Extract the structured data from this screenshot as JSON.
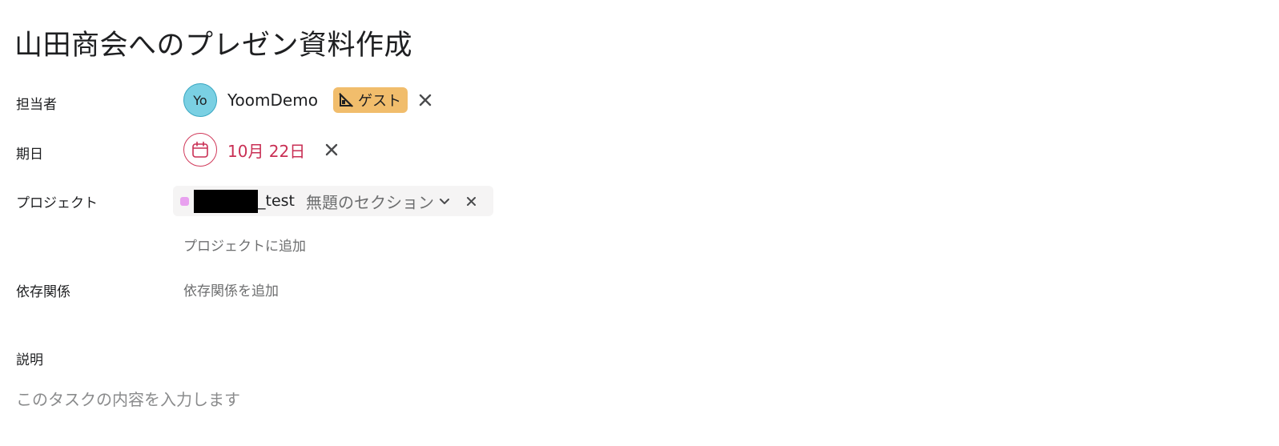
{
  "task": {
    "title": "山田商会へのプレゼン資料作成"
  },
  "fields": {
    "assignee": {
      "label": "担当者",
      "avatar_initials": "Yo",
      "name": "YoomDemo",
      "badge_label": "ゲスト",
      "badge_icon": "guest-icon",
      "remove_icon": "close-icon"
    },
    "due_date": {
      "label": "期日",
      "icon": "calendar-icon",
      "value": "10月 22日",
      "remove_icon": "close-icon"
    },
    "project": {
      "label": "プロジェクト",
      "project_name": "_test",
      "section_name": "無題のセクション",
      "add_link": "プロジェクトに追加"
    },
    "dependencies": {
      "label": "依存関係",
      "add_link": "依存関係を追加"
    },
    "description": {
      "label": "説明",
      "placeholder": "このタスクの内容を入力します"
    }
  },
  "colors": {
    "avatar_bg": "#7ad0e3",
    "guest_badge_bg": "#f1bd6c",
    "due_date_red": "#c92f54",
    "project_dot": "#e8a1ef",
    "chip_bg": "#f5f4f4"
  }
}
